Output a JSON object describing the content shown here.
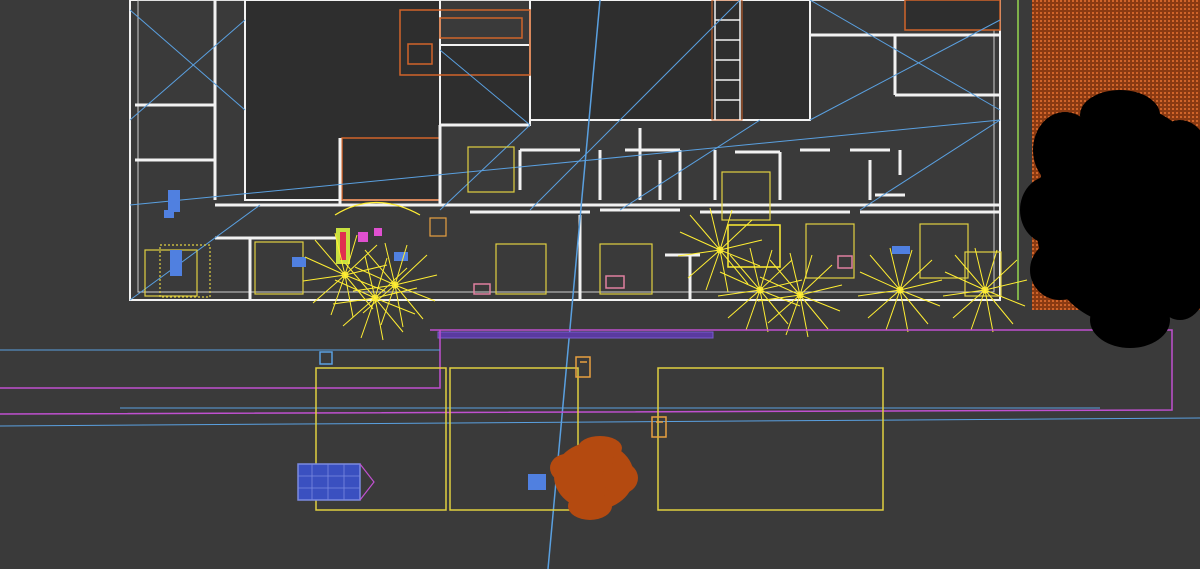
{
  "viewport": {
    "label": "",
    "background": "#3a3a3a"
  },
  "colors": {
    "wall": "#f2f2f2",
    "light": "#ffee33",
    "selection": "#e0d040",
    "guide": "#5aa0e0",
    "spline": "#c050d0",
    "furniture_orange": "#d0642a",
    "furniture_blue": "#5080e0",
    "tree": "#000000",
    "shrub": "#b44a10",
    "grass_hatch": "#c0541c",
    "camera": "#e8a040"
  },
  "icons": [
    "camera-icon",
    "light-icon",
    "tree-object",
    "shrub-object",
    "spline-path",
    "building-plan"
  ]
}
